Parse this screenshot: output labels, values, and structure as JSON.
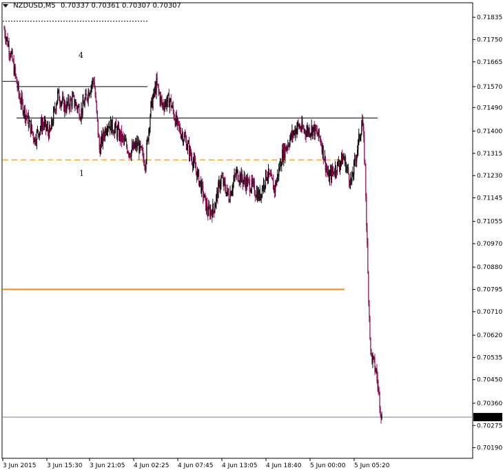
{
  "header": {
    "symbol": "NZDUSD,M5",
    "ohlc": "0.70337 0.70361 0.70307 0.70307"
  },
  "colors": {
    "up": "#000000",
    "down": "#8b0a50",
    "shadow": "#b4b4b4",
    "level_orange": "#f08c14",
    "bid_line": "#708090",
    "current_price_bg": "#000000"
  },
  "chart_data": {
    "type": "candlestick",
    "symbol": "NZDUSD",
    "timeframe": "M5",
    "ylim": [
      0.7016,
      0.7188
    ],
    "y_ticks": [
      "0.71835",
      "0.71750",
      "0.71665",
      "0.71570",
      "0.71490",
      "0.71400",
      "0.71315",
      "0.71230",
      "0.71145",
      "0.71055",
      "0.70970",
      "0.70880",
      "0.70795",
      "0.70710",
      "0.70620",
      "0.70535",
      "0.70450",
      "0.70360",
      "0.70275",
      "0.70190"
    ],
    "current_price": "0.70307",
    "x_ticks": [
      "3 Jun 2015",
      "3 Jun 15:30",
      "3 Jun 21:05",
      "4 Jun 02:25",
      "4 Jun 07:45",
      "4 Jun 13:05",
      "4 Jun 18:40",
      "5 Jun 00:00",
      "5 Jun 05:20"
    ],
    "annotations": [
      {
        "text": "4",
        "price": 0.7169
      },
      {
        "text": "1",
        "price": 0.7124
      }
    ],
    "levels": [
      {
        "price": 0.7182,
        "style": "dotted",
        "color": "black"
      },
      {
        "price": 0.7159,
        "style": "solid",
        "color": "black"
      },
      {
        "price": 0.7157,
        "style": "solid",
        "color": "black"
      },
      {
        "price": 0.7145,
        "style": "solid",
        "color": "black"
      },
      {
        "price": 0.7129,
        "style": "dashed",
        "color": "orange"
      },
      {
        "price": 0.70795,
        "style": "solid",
        "color": "orange"
      },
      {
        "price": 0.70307,
        "style": "solid",
        "color": "slategray"
      }
    ],
    "price_path": [
      [
        0,
        0.7179
      ],
      [
        3,
        0.7168
      ],
      [
        6,
        0.7153
      ],
      [
        9,
        0.7145
      ],
      [
        12,
        0.7137
      ],
      [
        15,
        0.7143
      ],
      [
        18,
        0.7139
      ],
      [
        21,
        0.7154
      ],
      [
        24,
        0.7149
      ],
      [
        27,
        0.7152
      ],
      [
        30,
        0.7147
      ],
      [
        33,
        0.7155
      ],
      [
        35,
        0.716
      ],
      [
        37,
        0.7133
      ],
      [
        40,
        0.7143
      ],
      [
        43,
        0.7141
      ],
      [
        46,
        0.7137
      ],
      [
        49,
        0.7132
      ],
      [
        52,
        0.7135
      ],
      [
        55,
        0.7128
      ],
      [
        57,
        0.7149
      ],
      [
        59,
        0.7158
      ],
      [
        61,
        0.715
      ],
      [
        64,
        0.7152
      ],
      [
        67,
        0.7142
      ],
      [
        70,
        0.7137
      ],
      [
        73,
        0.7129
      ],
      [
        76,
        0.712
      ],
      [
        79,
        0.7109
      ],
      [
        81,
        0.711
      ],
      [
        84,
        0.7122
      ],
      [
        87,
        0.7115
      ],
      [
        90,
        0.7124
      ],
      [
        93,
        0.7121
      ],
      [
        96,
        0.7119
      ],
      [
        99,
        0.7115
      ],
      [
        102,
        0.7124
      ],
      [
        105,
        0.7118
      ],
      [
        108,
        0.7131
      ],
      [
        111,
        0.7137
      ],
      [
        114,
        0.7142
      ],
      [
        117,
        0.714
      ],
      [
        120,
        0.7141
      ],
      [
        123,
        0.7137
      ],
      [
        126,
        0.7122
      ],
      [
        129,
        0.7126
      ],
      [
        132,
        0.713
      ],
      [
        135,
        0.712
      ],
      [
        137,
        0.7132
      ],
      [
        139,
        0.7144
      ],
      [
        140,
        0.7126
      ],
      [
        141,
        0.7085
      ],
      [
        142,
        0.7055
      ],
      [
        144,
        0.7048
      ],
      [
        146,
        0.703
      ]
    ]
  }
}
